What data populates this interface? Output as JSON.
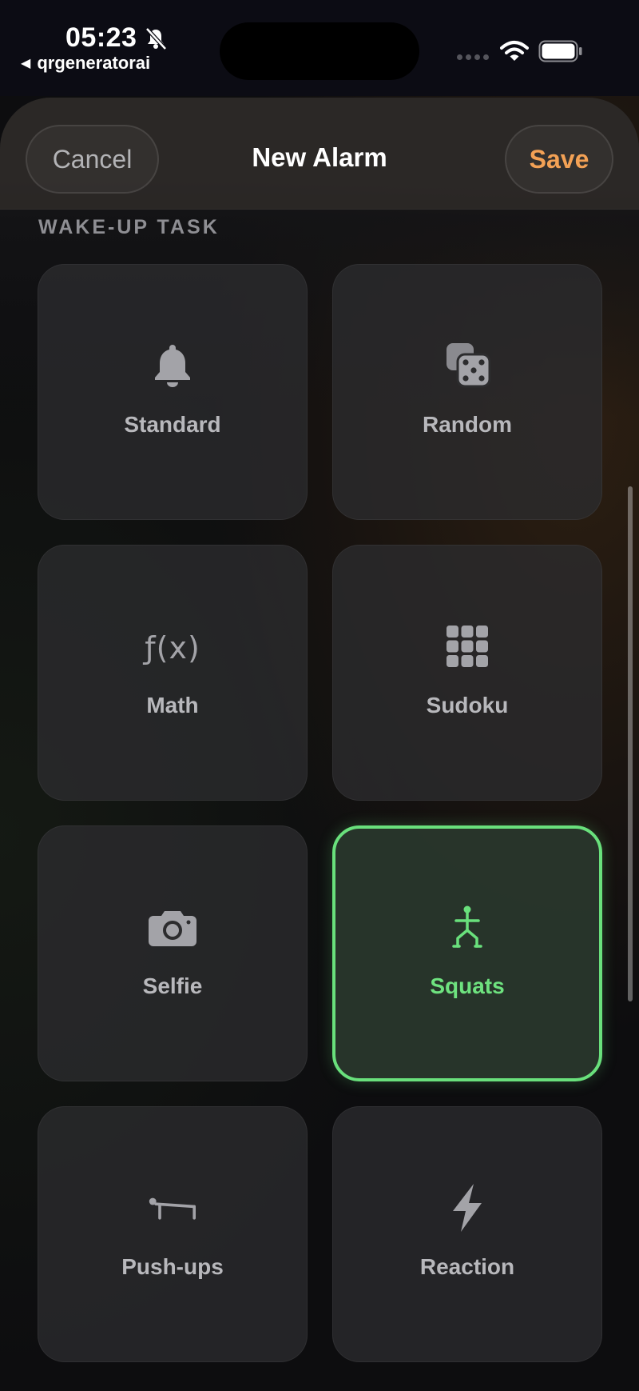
{
  "status_bar": {
    "time": "05:23",
    "back_app": "qrgeneratorai",
    "mute_icon": "bell-slash-icon",
    "wifi_icon": "wifi-icon",
    "battery_icon": "battery-icon"
  },
  "nav": {
    "cancel_label": "Cancel",
    "title": "New Alarm",
    "save_label": "Save"
  },
  "section": {
    "label": "WAKE-UP TASK"
  },
  "tasks": [
    {
      "label": "Standard",
      "icon": "bell-icon",
      "selected": false
    },
    {
      "label": "Random",
      "icon": "dice-icon",
      "selected": false
    },
    {
      "label": "Math",
      "icon": "function-icon",
      "icon_text": "ƒ",
      "icon_text_2": "(x)",
      "selected": false
    },
    {
      "label": "Sudoku",
      "icon": "grid-icon",
      "selected": false
    },
    {
      "label": "Selfie",
      "icon": "camera-icon",
      "selected": false
    },
    {
      "label": "Squats",
      "icon": "squat-figure-icon",
      "selected": true
    },
    {
      "label": "Push-ups",
      "icon": "pushup-figure-icon",
      "selected": false
    },
    {
      "label": "Reaction",
      "icon": "bolt-icon",
      "selected": false
    }
  ],
  "colors": {
    "accent_save": "#f3a155",
    "selected_green": "#69e07c",
    "icon_gray": "#a3a3a8"
  }
}
